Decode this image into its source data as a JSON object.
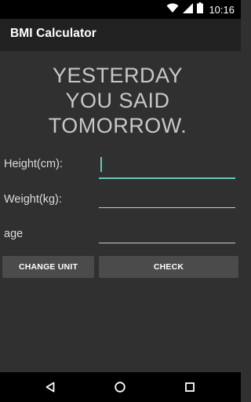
{
  "status_bar": {
    "time": "10:16",
    "icons": [
      "wifi-icon",
      "cell-signal-icon",
      "battery-icon"
    ]
  },
  "app": {
    "title": "BMI Calculator"
  },
  "headline": {
    "lines": [
      "YESTERDAY",
      "YOU SAID",
      "TOMORROW."
    ]
  },
  "form": {
    "height_label": "Height(cm):",
    "height_value": "",
    "weight_label": "Weight(kg):",
    "weight_value": "",
    "age_label": "age",
    "age_value": ""
  },
  "buttons": {
    "change_unit": "CHANGE UNIT",
    "check": "CHECK"
  },
  "nav_bar": {
    "icons": [
      "back-icon",
      "home-icon",
      "recents-icon"
    ]
  },
  "colors": {
    "background": "#303030",
    "action_bar": "#212121",
    "accent": "#64c8c0",
    "button": "#4b4b4b"
  }
}
